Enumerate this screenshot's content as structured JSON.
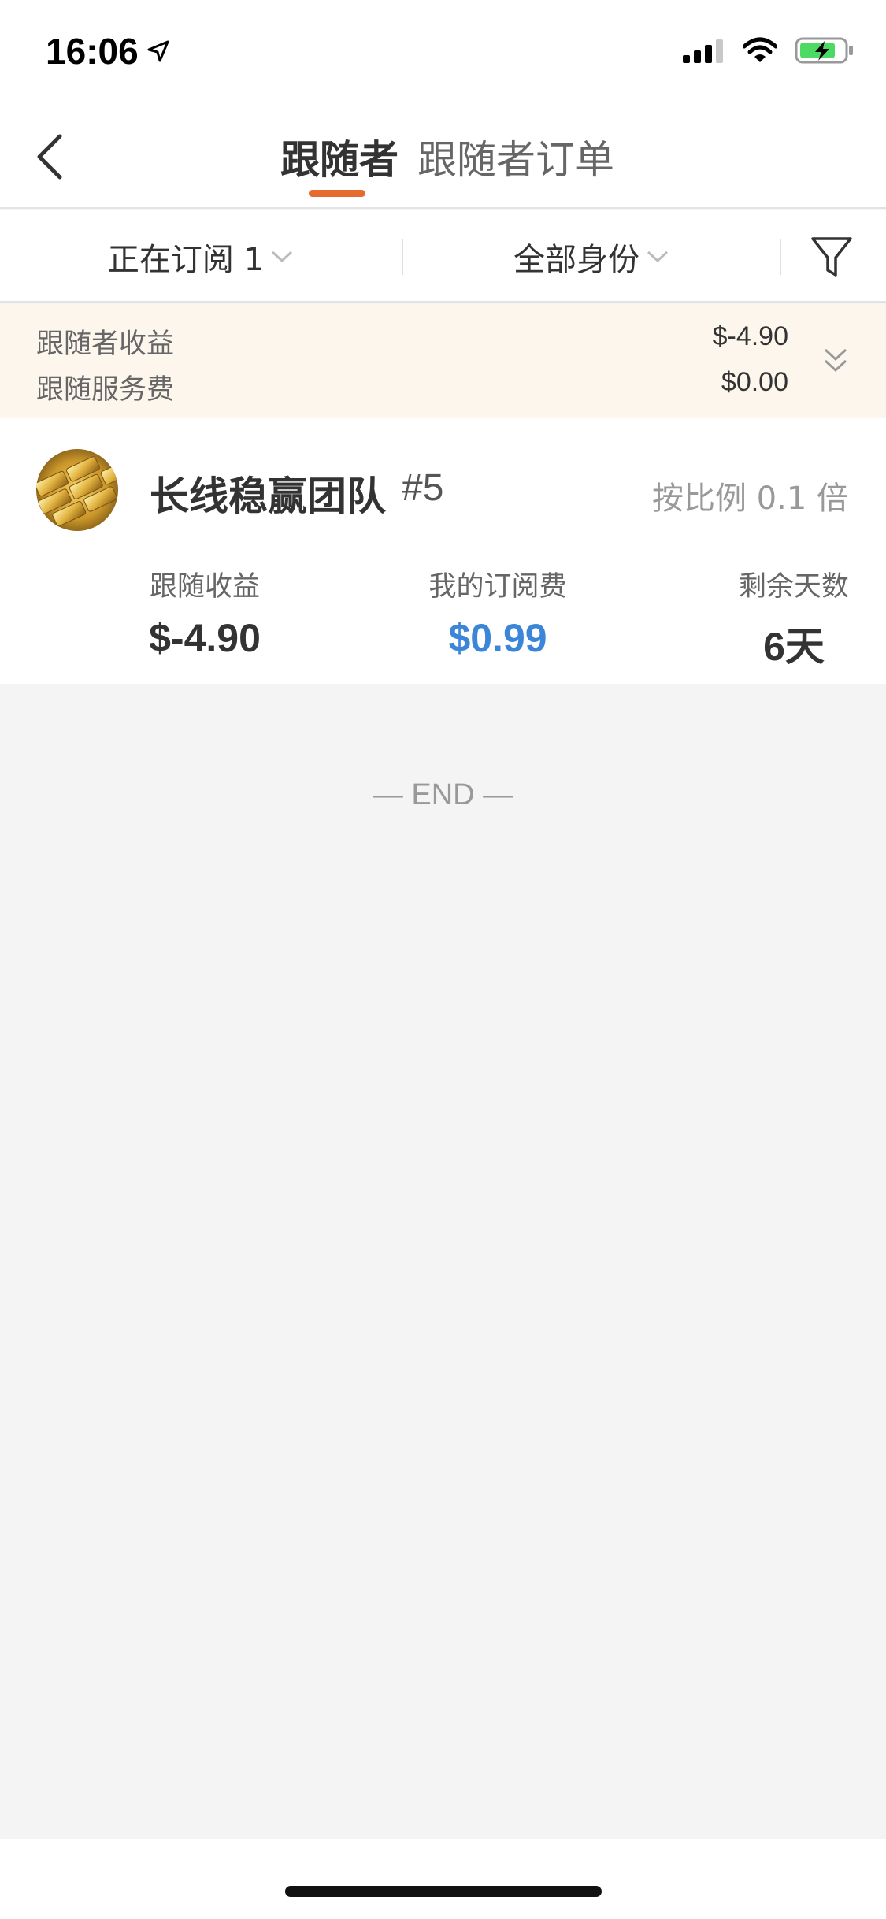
{
  "status_bar": {
    "time": "16:06"
  },
  "nav": {
    "tabs": [
      {
        "label": "跟随者",
        "active": true
      },
      {
        "label": "跟随者订单",
        "active": false
      }
    ],
    "accent_color": "#e66b2e"
  },
  "filters": {
    "subscription": "正在订阅 1",
    "identity": "全部身份"
  },
  "summary": {
    "follower_income_label": "跟随者收益",
    "follower_income_value": "$-4.90",
    "service_fee_label": "跟随服务费",
    "service_fee_value": "$0.00"
  },
  "card": {
    "title": "长线稳赢团队",
    "number": "#5",
    "ratio": "按比例 0.1 倍",
    "stats": [
      {
        "label": "跟随收益",
        "value": "$-4.90",
        "color": "#333333"
      },
      {
        "label": "我的订阅费",
        "value": "$0.99",
        "color": "#3b86d8"
      },
      {
        "label": "剩余天数",
        "value": "6天",
        "color": "#333333"
      }
    ]
  },
  "end_text": "— END —"
}
